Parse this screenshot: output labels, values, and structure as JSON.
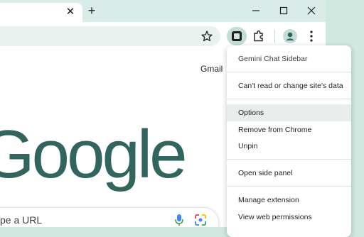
{
  "browser": {
    "tab_close_glyph": "✕",
    "new_tab_glyph": "+"
  },
  "page": {
    "header_link": "Gmail",
    "logo_text": "Google",
    "search_placeholder_visible": "pe a URL"
  },
  "extension_menu": {
    "title": "Gemini Chat Sidebar",
    "site_access": "Can't read or change site's data",
    "items": [
      {
        "label": "Options",
        "highlighted": true
      },
      {
        "label": "Remove from Chrome"
      },
      {
        "label": "Unpin"
      },
      {
        "label": "Open side panel"
      },
      {
        "label": "Manage extension"
      },
      {
        "label": "View web permissions"
      }
    ]
  },
  "colors": {
    "frame": "#d9ece7",
    "logo": "#31655d",
    "active_extension_bg": "#c4ddd7"
  }
}
